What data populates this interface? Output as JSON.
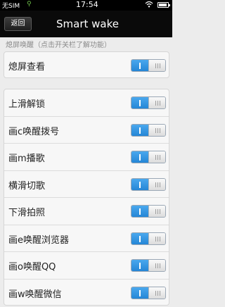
{
  "status_bar": {
    "carrier": "无SIM",
    "usb_icon": "usb-icon",
    "time": "17:54",
    "wifi_icon": "wifi-icon",
    "battery_icon": "battery-icon",
    "battery_level": 0.8
  },
  "title_bar": {
    "back_label": "返回",
    "title": "Smart wake"
  },
  "section_hint": "熄屏唤醒（点击开关栏了解功能）",
  "screen_off_view": {
    "label": "熄屏查看",
    "enabled": true
  },
  "gestures": [
    {
      "label": "上滑解锁",
      "enabled": true
    },
    {
      "label": "画c唤醒拨号",
      "enabled": true
    },
    {
      "label": "画m播歌",
      "enabled": true
    },
    {
      "label": "横滑切歌",
      "enabled": true
    },
    {
      "label": "下滑拍照",
      "enabled": true
    },
    {
      "label": "画e唤醒浏览器",
      "enabled": true
    },
    {
      "label": "画o唤醒QQ",
      "enabled": true
    },
    {
      "label": "画w唤醒微信",
      "enabled": true
    }
  ],
  "colors": {
    "toggle_on": "#2f8fe0",
    "title_bar_bg": "#0a0a0a",
    "page_bg": "#ececec"
  }
}
